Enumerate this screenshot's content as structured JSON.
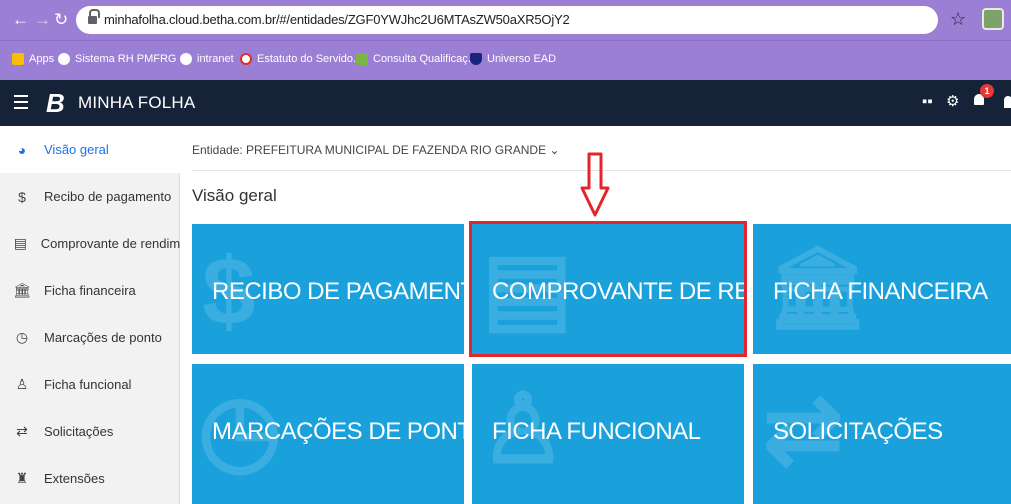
{
  "browser": {
    "url": "minhafolha.cloud.betha.com.br/#/entidades/ZGF0YWJhc2U6MTAsZW50aXR5OjY2",
    "bookmarks": [
      {
        "label": "Apps",
        "color": "#fbbc05"
      },
      {
        "label": "Sistema RH PMFRG",
        "color": "#4285f4"
      },
      {
        "label": "intranet",
        "color": "#4285f4"
      },
      {
        "label": "Estatuto do Servido...",
        "color": "#d93025"
      },
      {
        "label": "Consulta Qualificaç...",
        "color": "#7cb342"
      },
      {
        "label": "Universo EAD",
        "color": "#1a237e"
      }
    ]
  },
  "app": {
    "logo": "B",
    "title": "MINHA FOLHA",
    "notifications": "1"
  },
  "sidebar": {
    "items": [
      {
        "label": "Visão geral",
        "icon": "pie-chart-icon",
        "glyph": "◕"
      },
      {
        "label": "Recibo de pagamento",
        "icon": "dollar-icon",
        "glyph": "$"
      },
      {
        "label": "Comprovante de rendim...",
        "icon": "document-icon",
        "glyph": "▤"
      },
      {
        "label": "Ficha financeira",
        "icon": "bank-icon",
        "glyph": "🏛"
      },
      {
        "label": "Marcações de ponto",
        "icon": "clock-icon",
        "glyph": "◷"
      },
      {
        "label": "Ficha funcional",
        "icon": "user-icon",
        "glyph": "♙"
      },
      {
        "label": "Solicitações",
        "icon": "exchange-icon",
        "glyph": "⇄"
      },
      {
        "label": "Extensões",
        "icon": "puzzle-icon",
        "glyph": "♜"
      }
    ]
  },
  "main": {
    "entity": "Entidade: PREFEITURA MUNICIPAL DE FAZENDA RIO GRANDE",
    "page_title": "Visão geral",
    "tiles": [
      {
        "label": "RECIBO DE PAGAMENTO",
        "bg_glyph": "$"
      },
      {
        "label": "COMPROVANTE DE REN...",
        "bg_glyph": "▤"
      },
      {
        "label": "FICHA FINANCEIRA",
        "bg_glyph": "🏛"
      },
      {
        "label": "MARCAÇÕES DE PONTO",
        "bg_glyph": "◷"
      },
      {
        "label": "FICHA FUNCIONAL",
        "bg_glyph": "♙"
      },
      {
        "label": "SOLICITAÇÕES",
        "bg_glyph": "⇄"
      }
    ]
  },
  "colors": {
    "browser_bar": "#9b7fd4",
    "app_header": "#152237",
    "tile": "#1aa1dc",
    "highlight": "#e3262b"
  }
}
